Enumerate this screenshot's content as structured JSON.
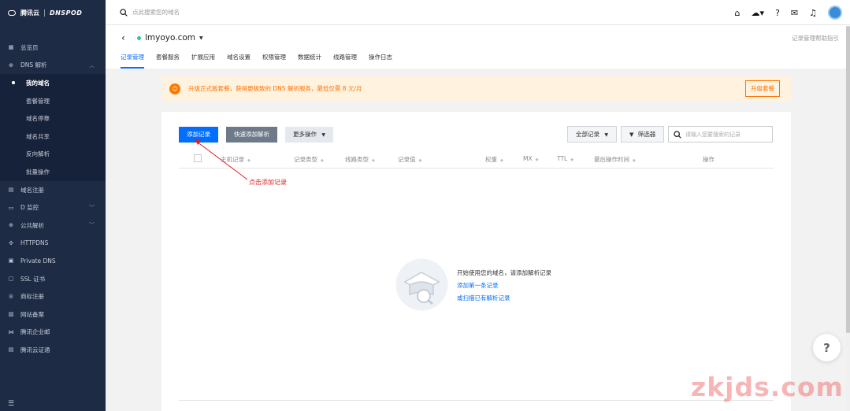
{
  "sidebar": {
    "logo_text": "腾讯云",
    "logo_brand": "DNSPOD",
    "items": [
      {
        "label": "总览页",
        "icon": "grid-icon"
      },
      {
        "label": "DNS 解析",
        "icon": "globe-icon",
        "expanded": true
      },
      {
        "label": "域名注册",
        "icon": "card-icon"
      },
      {
        "label": "D 监控",
        "icon": "monitor-icon"
      },
      {
        "label": "公共解析",
        "icon": "globe-icon"
      },
      {
        "label": "HTTPDNS",
        "icon": "nodes-icon"
      },
      {
        "label": "Private DNS",
        "icon": "lock-icon"
      },
      {
        "label": "SSL 证书",
        "icon": "certificate-icon"
      },
      {
        "label": "商标注册",
        "icon": "registered-icon"
      },
      {
        "label": "网站备案",
        "icon": "file-icon"
      },
      {
        "label": "腾讯企业邮",
        "icon": "mail-icon"
      },
      {
        "label": "腾讯云证通",
        "icon": "id-icon"
      }
    ],
    "sub_items": [
      {
        "label": "我的域名",
        "active": true
      },
      {
        "label": "套餐管理"
      },
      {
        "label": "域名停靠"
      },
      {
        "label": "域名共享"
      },
      {
        "label": "反向解析"
      },
      {
        "label": "批量操作"
      }
    ]
  },
  "topbar": {
    "search_placeholder": "点此搜索您的域名"
  },
  "header": {
    "domain": "lmyoyo.com",
    "help_link": "记录管理帮助指引",
    "tabs": [
      "记录管理",
      "套餐服务",
      "扩展应用",
      "域名设置",
      "权限管理",
      "数据统计",
      "线路管理",
      "操作日志"
    ],
    "active_tab": 0
  },
  "banner": {
    "text": "升级正式版套餐，获得更极致的 DNS 解析服务，最低仅需 8 元/月",
    "button": "升级套餐"
  },
  "toolbar": {
    "add_record": "添加记录",
    "quick_add": "快速添加解析",
    "more_ops": "更多操作",
    "all_records": "全部记录",
    "filter": "筛选器",
    "search_placeholder": "请输入您要搜索的记录"
  },
  "table": {
    "columns": [
      "主机记录",
      "记录类型",
      "线路类型",
      "记录值",
      "权重",
      "MX",
      "TTL",
      "最后操作时间",
      "操作"
    ]
  },
  "empty_state": {
    "text": "开始使用您的域名，请添加解析记录",
    "link1": "添加第一条记录",
    "link2": "或扫描已有解析记录"
  },
  "annotation": {
    "text": "点击添加记录",
    "color": "#e02020"
  },
  "help_float": "?",
  "watermark": "zkjds.com",
  "colors": {
    "accent": "#006eff",
    "sidebar_bg": "#1d2b45",
    "banner_bg": "#fff3e0",
    "banner_text": "#ff7200"
  }
}
